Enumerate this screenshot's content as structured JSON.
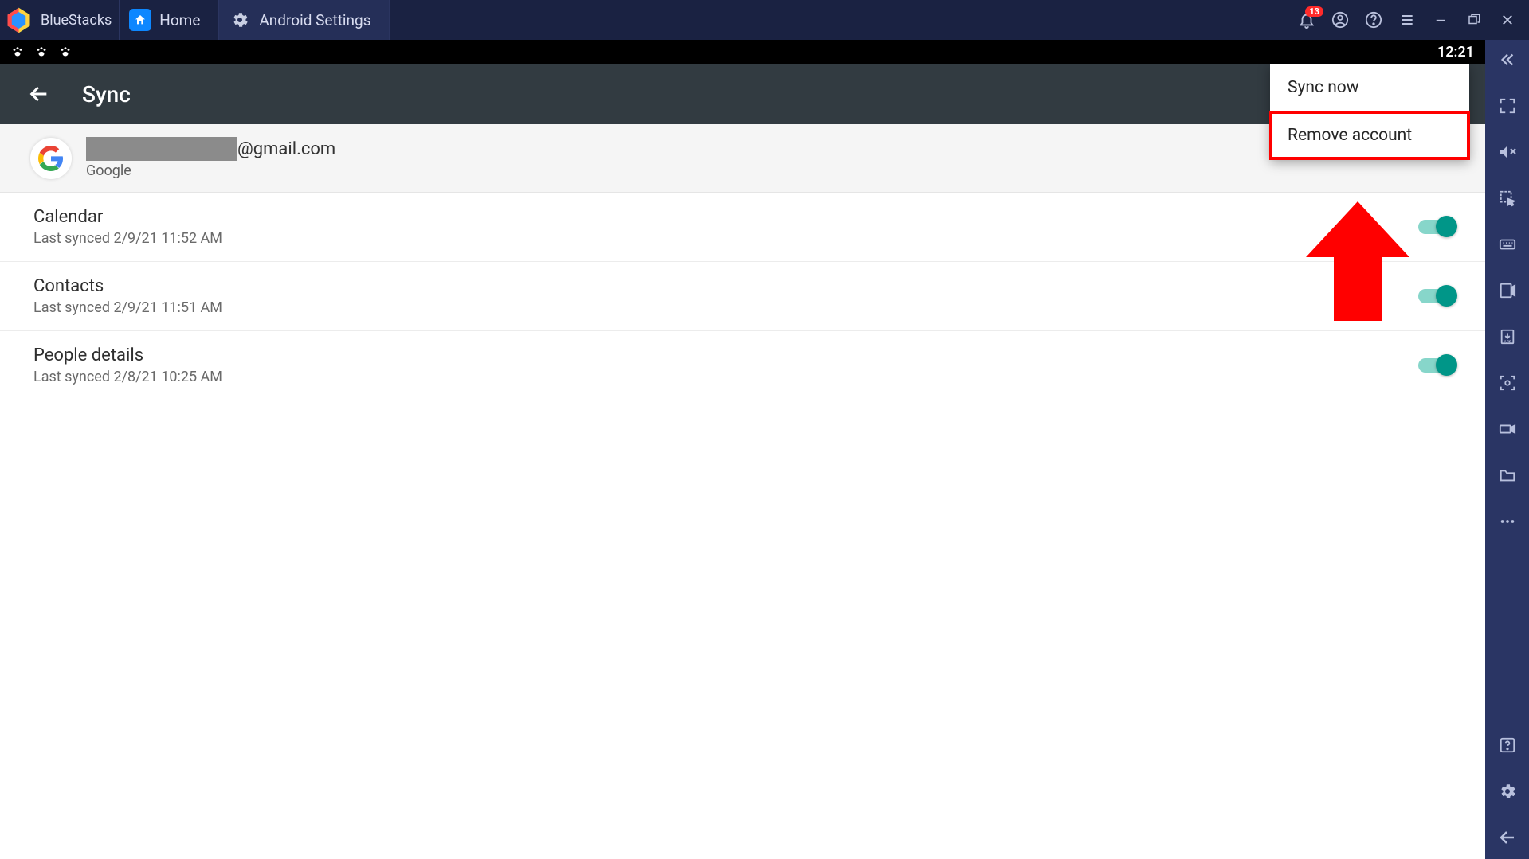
{
  "titlebar": {
    "app_name": "BlueStacks",
    "tabs": [
      {
        "label": "Home"
      },
      {
        "label": "Android Settings"
      }
    ],
    "notification_count": "13"
  },
  "status": {
    "time": "12:21"
  },
  "appbar": {
    "title": "Sync"
  },
  "account": {
    "email_suffix": "@gmail.com",
    "provider": "Google"
  },
  "sync_items": [
    {
      "title": "Calendar",
      "sub": "Last synced 2/9/21 11:52 AM"
    },
    {
      "title": "Contacts",
      "sub": "Last synced 2/9/21 11:51 AM"
    },
    {
      "title": "People details",
      "sub": "Last synced 2/8/21 10:25 AM"
    }
  ],
  "menu": {
    "sync_now": "Sync now",
    "remove_account": "Remove account"
  },
  "icons": {
    "bell": "bell-icon",
    "account": "account-icon",
    "help": "help-icon",
    "menu": "hamburger-icon",
    "min": "minimize-icon",
    "max": "maximize-icon",
    "close": "close-icon",
    "collapse": "chevron-left-icon",
    "fullscreen": "fullscreen-icon",
    "mute": "volume-mute-icon",
    "selection": "selection-icon",
    "keyboard": "keyboard-icon",
    "media": "media-icon",
    "apk": "install-apk-icon",
    "capture": "capture-icon",
    "record": "record-icon",
    "folder": "folder-icon",
    "more": "more-icon",
    "unknown": "help-square-icon",
    "settings": "settings-gear-icon",
    "back_side": "back-arrow-icon"
  }
}
